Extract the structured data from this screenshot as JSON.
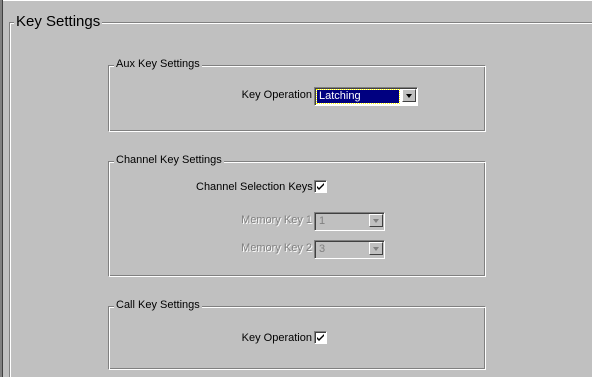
{
  "key_settings": {
    "title": "Key Settings"
  },
  "aux_key_settings": {
    "title": "Aux Key Settings",
    "key_operation_label": "Key Operation",
    "key_operation_value": "Latching"
  },
  "channel_key_settings": {
    "title": "Channel Key Settings",
    "channel_selection_label": "Channel Selection Keys",
    "channel_selection_checked": true,
    "memory_key_1_label": "Memory Key 1",
    "memory_key_1_value": "1",
    "memory_key_2_label": "Memory Key 2",
    "memory_key_2_value": "3"
  },
  "call_key_settings": {
    "title": "Call Key Settings",
    "key_operation_label": "Key Operation",
    "key_operation_checked": true
  },
  "icons": {
    "dropdown": "chevron-down-icon",
    "check": "checkmark-icon"
  },
  "colors": {
    "face": "#c0c0c0",
    "selection": "#000080",
    "disabled_text": "#808080"
  }
}
